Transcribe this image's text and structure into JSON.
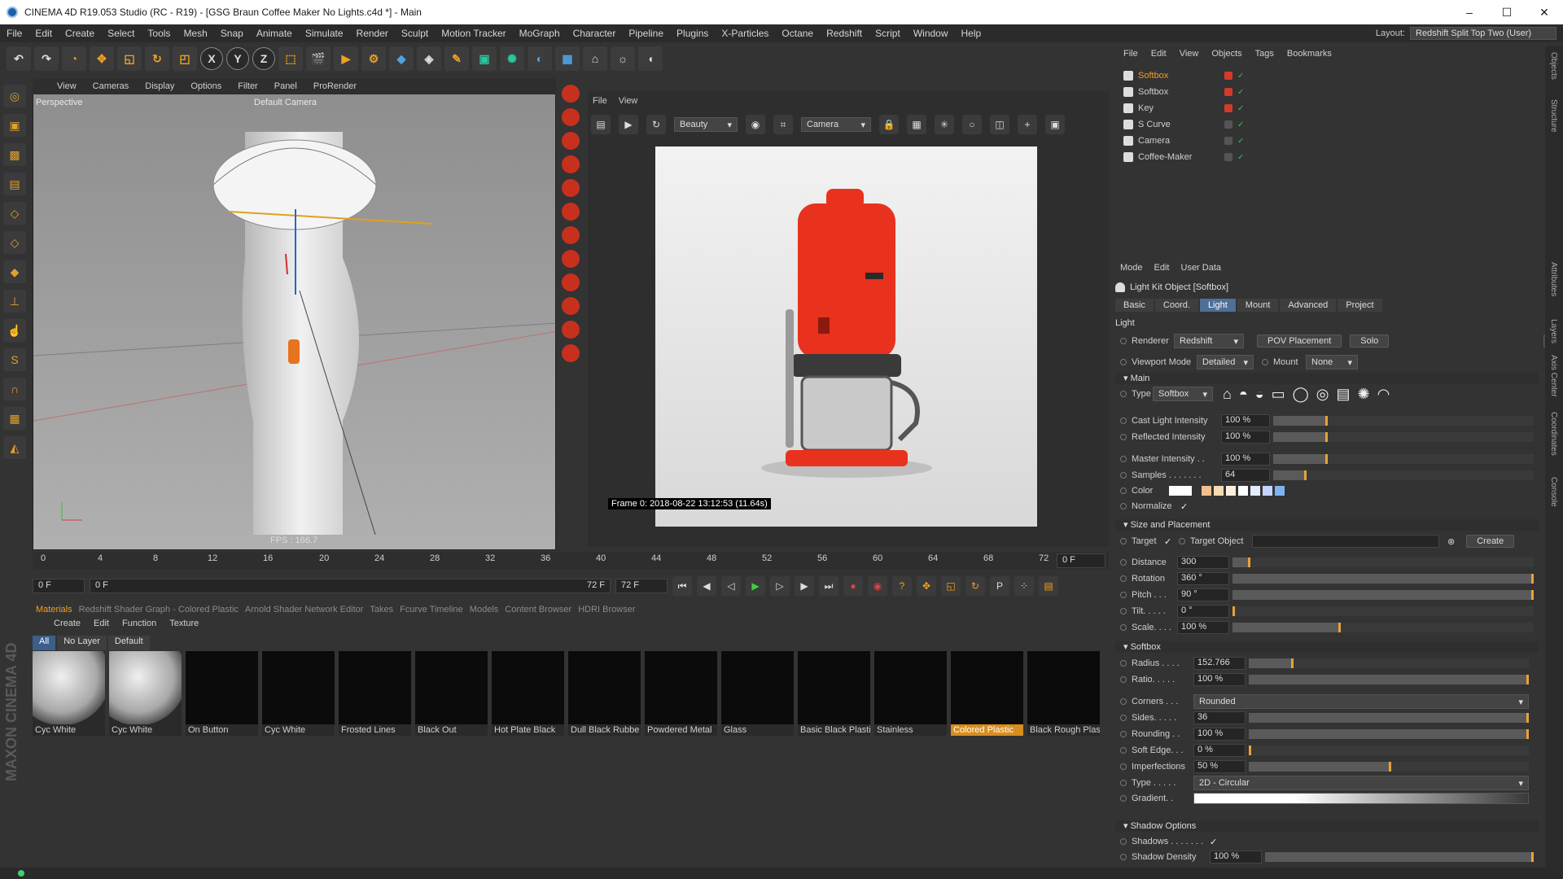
{
  "window": {
    "title": "CINEMA 4D R19.053 Studio (RC - R19) - [GSG Braun Coffee Maker No Lights.c4d *] - Main",
    "controls": [
      "–",
      "☐",
      "✕"
    ]
  },
  "menubar": {
    "items": [
      "File",
      "Edit",
      "Create",
      "Select",
      "Tools",
      "Mesh",
      "Snap",
      "Animate",
      "Simulate",
      "Render",
      "Sculpt",
      "Motion Tracker",
      "MoGraph",
      "Character",
      "Pipeline",
      "Plugins",
      "X-Particles",
      "Octane",
      "Redshift",
      "Script",
      "Window",
      "Help"
    ],
    "layout_label": "Layout:",
    "layout_value": "Redshift Split Top Two (User)"
  },
  "toolbar": {
    "axis_labels": [
      "X",
      "Y",
      "Z"
    ]
  },
  "viewport": {
    "menu": [
      "View",
      "Cameras",
      "Display",
      "Options",
      "Filter",
      "Panel",
      "ProRender"
    ],
    "label": "Perspective",
    "camera": "Default Camera",
    "fps": "FPS : 166.7"
  },
  "render_view": {
    "menu": [
      "File",
      "View"
    ],
    "pass": "Beauty",
    "camera": "Camera",
    "stamp": "Frame 0: 2018-08-22 13:12:53 (11.64s)"
  },
  "timeline": {
    "ticks": [
      "0",
      "4",
      "8",
      "12",
      "16",
      "20",
      "24",
      "28",
      "32",
      "36",
      "40",
      "44",
      "48",
      "52",
      "56",
      "60",
      "64",
      "68",
      "72"
    ],
    "current_frame": "0 F",
    "start_field": "0 F",
    "range_start": "0 F",
    "range_end": "72 F",
    "end_field": "72 F"
  },
  "materials": {
    "tabs": [
      "Materials",
      "Redshift Shader Graph - Colored Plastic",
      "Arnold Shader Network Editor",
      "Takes",
      "Fcurve Timeline",
      "Models",
      "Content Browser",
      "HDRI Browser"
    ],
    "menu": [
      "Create",
      "Edit",
      "Function",
      "Texture"
    ],
    "filters": [
      "All",
      "No Layer",
      "Default"
    ],
    "items": [
      {
        "name": "Cyc White",
        "sphere": true
      },
      {
        "name": "Cyc White",
        "sphere": true
      },
      {
        "name": "On Button",
        "sphere": false
      },
      {
        "name": "Cyc White",
        "sphere": false
      },
      {
        "name": "Frosted Lines",
        "sphere": false
      },
      {
        "name": "Black Out",
        "sphere": false
      },
      {
        "name": "Hot Plate Black",
        "sphere": false
      },
      {
        "name": "Dull Black Rubbe",
        "sphere": false
      },
      {
        "name": "Powdered Metal",
        "sphere": false
      },
      {
        "name": "Glass",
        "sphere": false
      },
      {
        "name": "Basic Black Plasti",
        "sphere": false
      },
      {
        "name": "Stainless",
        "sphere": false
      },
      {
        "name": "Colored Plastic",
        "sphere": false,
        "selected": true
      },
      {
        "name": "Black Rough Plas",
        "sphere": false
      }
    ]
  },
  "object_manager": {
    "menu": [
      "File",
      "Edit",
      "View",
      "Objects",
      "Tags",
      "Bookmarks"
    ],
    "objects": [
      {
        "name": "Softbox",
        "selected": true,
        "flag": "#d43a2a"
      },
      {
        "name": "Softbox",
        "selected": false,
        "flag": "#d43a2a"
      },
      {
        "name": "Key",
        "selected": false,
        "flag": "#d43a2a"
      },
      {
        "name": "S Curve",
        "selected": false,
        "flag": "#555555"
      },
      {
        "name": "Camera",
        "selected": false,
        "flag": "#555555"
      },
      {
        "name": "Coffee-Maker",
        "selected": false,
        "flag": "#555555"
      }
    ]
  },
  "attribute_manager": {
    "menu": [
      "Mode",
      "Edit",
      "User Data"
    ],
    "title": "Light Kit Object [Softbox]",
    "tabs": [
      "Basic",
      "Coord.",
      "Light",
      "Mount",
      "Advanced",
      "Project"
    ],
    "active_tab": "Light",
    "section_light": "Light",
    "renderer_label": "Renderer",
    "renderer_value": "Redshift",
    "pov_button": "POV Placement",
    "solo_button": "Solo",
    "help_button": "?",
    "viewport_mode_label": "Viewport Mode",
    "viewport_mode_value": "Detailed",
    "mount_label": "Mount",
    "mount_value": "None",
    "section_main": "Main",
    "type_label": "Type",
    "type_value": "Softbox",
    "cast_light_label": "Cast Light Intensity",
    "cast_light_value": "100 %",
    "reflected_label": "Reflected Intensity",
    "reflected_value": "100 %",
    "master_label": "Master Intensity . .",
    "master_value": "100 %",
    "samples_label": "Samples . . . . . . .",
    "samples_value": "64",
    "color_label": "Color",
    "normalize_label": "Normalize",
    "section_size": "Size and Placement",
    "target_label": "Target",
    "target_object_label": "Target Object",
    "create_button": "Create",
    "distance_label": "Distance",
    "distance_value": "300",
    "rotation_label": "Rotation",
    "rotation_value": "360 °",
    "pitch_label": "Pitch . . .",
    "pitch_value": "90 °",
    "tilt_label": "Tilt. . . . .",
    "tilt_value": "0 °",
    "scale_label": "Scale. . . .",
    "scale_value": "100 %",
    "section_softbox": "Softbox",
    "radius_label": "Radius . . . .",
    "radius_value": "152.766",
    "ratio_label": "Ratio. . . . .",
    "ratio_value": "100 %",
    "corners_label": "Corners . . .",
    "corners_value": "Rounded",
    "sides_label": "Sides. . . . .",
    "sides_value": "36",
    "rounding_label": "Rounding . .",
    "rounding_value": "100 %",
    "soft_edge_label": "Soft Edge. . .",
    "soft_edge_value": "0 %",
    "imperfections_label": "Imperfections",
    "imperfections_value": "50 %",
    "gtype_label": "Type . . . . .",
    "gtype_value": "2D - Circular",
    "gradient_label": "Gradient. .",
    "section_shadow": "Shadow Options",
    "shadows_label": "Shadows . . . . . . .",
    "shadow_density_label": "Shadow Density",
    "shadow_density_value": "100 %",
    "levels": {
      "cast_light": 0.2,
      "reflected": 0.2,
      "master": 0.2,
      "samples": 0.12,
      "distance": 0.05,
      "rotation": 1.0,
      "pitch": 1.0,
      "tilt": 0.0,
      "scale": 0.35,
      "radius": 0.15,
      "ratio": 1.0,
      "sides": 1.0,
      "rounding": 1.0,
      "soft_edge": 0.0,
      "imperfections": 0.5,
      "shadow_density": 1.0
    }
  },
  "side_tabs": [
    "Objects",
    "Structure",
    "Attributes",
    "Layers",
    "Axis Center",
    "Coordinates",
    "Console"
  ],
  "brand": "MAXON CINEMA 4D",
  "colors": {
    "accent": "#f0a020",
    "selected_tab": "#4f6f97",
    "render_red": "#e8321e"
  }
}
